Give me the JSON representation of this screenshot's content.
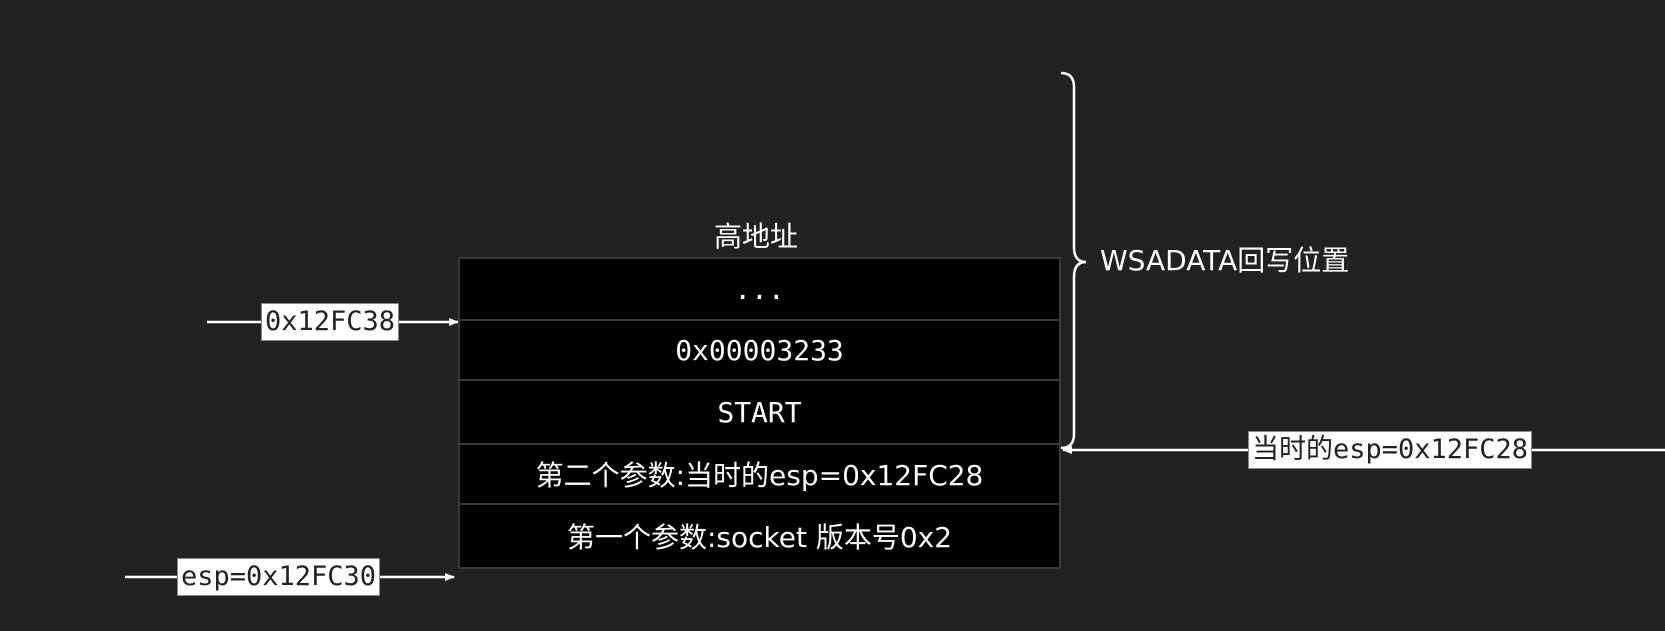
{
  "diagram": {
    "header_label": "高地址",
    "stack_cells": [
      {
        "text": "..."
      },
      {
        "text": "0x00003233"
      },
      {
        "text": "START"
      },
      {
        "text": "第二个参数:当时的esp=0x12FC28"
      },
      {
        "text": "第一个参数:socket 版本号0x2"
      }
    ],
    "pointer_labels": {
      "addr_38": "0x12FC38",
      "esp_30": "esp=0x12FC30",
      "esp_28": "当时的esp=0x12FC28"
    },
    "brace_label": "WSADATA回写位置"
  }
}
